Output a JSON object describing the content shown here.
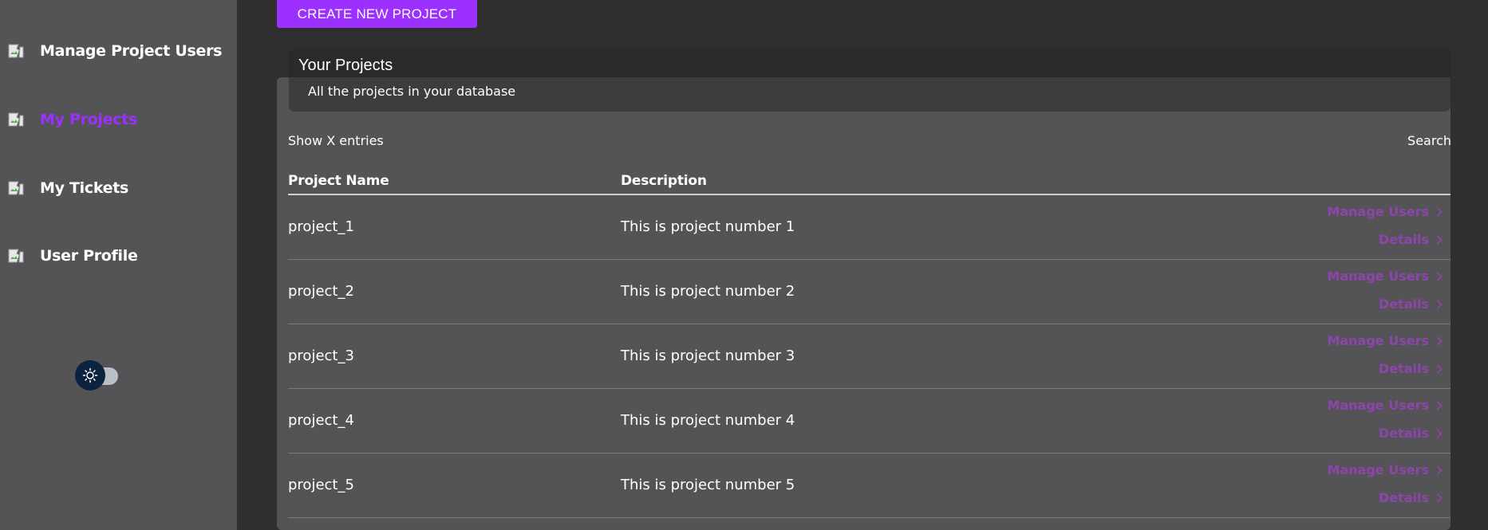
{
  "sidebar": {
    "items": [
      {
        "label": "Manage Project Users",
        "icon": "broken-image-icon",
        "active": false
      },
      {
        "label": "My Projects",
        "icon": "broken-image-icon",
        "active": true
      },
      {
        "label": "My Tickets",
        "icon": "broken-image-icon",
        "active": false
      },
      {
        "label": "User Profile",
        "icon": "broken-image-icon",
        "active": false
      }
    ],
    "theme_toggle_icon": "sun-icon"
  },
  "colors": {
    "accent": "#9b30ff",
    "action_link": "#8e44ad",
    "sidebar_bg": "#545456",
    "page_bg": "#2f2f2f",
    "toggle_knob": "#0c2340"
  },
  "toolbar": {
    "create_label": "CREATE NEW PROJECT"
  },
  "card": {
    "title": "Your Projects",
    "subtitle": "All the projects in your database"
  },
  "table": {
    "show_entries": "Show X entries",
    "search_label": "Search",
    "headers": [
      "Project Name",
      "Description"
    ],
    "action_labels": {
      "manage": "Manage Users",
      "details": "Details"
    },
    "rows": [
      {
        "name": "project_1",
        "description": "This is project number 1",
        "manage": "Manage Users",
        "details": "Details"
      },
      {
        "name": "project_2",
        "description": "This is project number 2",
        "manage": "Manage Users",
        "details": "Details"
      },
      {
        "name": "project_3",
        "description": "This is project number 3",
        "manage": "Manage Users",
        "details": "Details"
      },
      {
        "name": "project_4",
        "description": "This is project number 4",
        "manage": "Manage Users",
        "details": "Details"
      },
      {
        "name": "project_5",
        "description": "This is project number 5",
        "manage": "Manage Users",
        "details": "Details"
      }
    ]
  }
}
